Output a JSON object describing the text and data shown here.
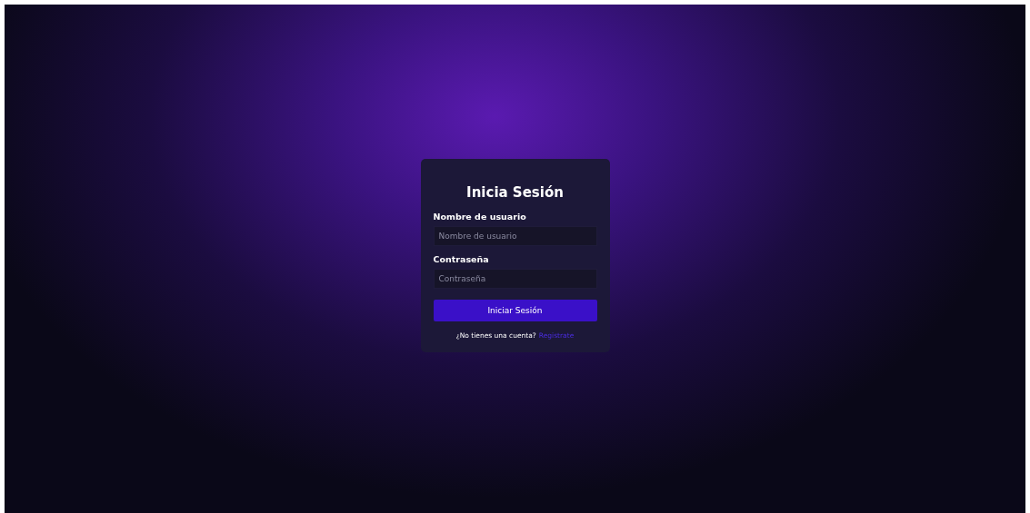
{
  "title": "Inicia Sesión",
  "fields": [
    {
      "label": "Nombre de usuario",
      "placeholder": "Nombre de usuario"
    },
    {
      "label": "Contraseña",
      "placeholder": "Contraseña"
    }
  ],
  "submit": "Iniciar Sesión",
  "footer": {
    "text": "¿No tienes una cuenta?",
    "link": "Registrate"
  }
}
